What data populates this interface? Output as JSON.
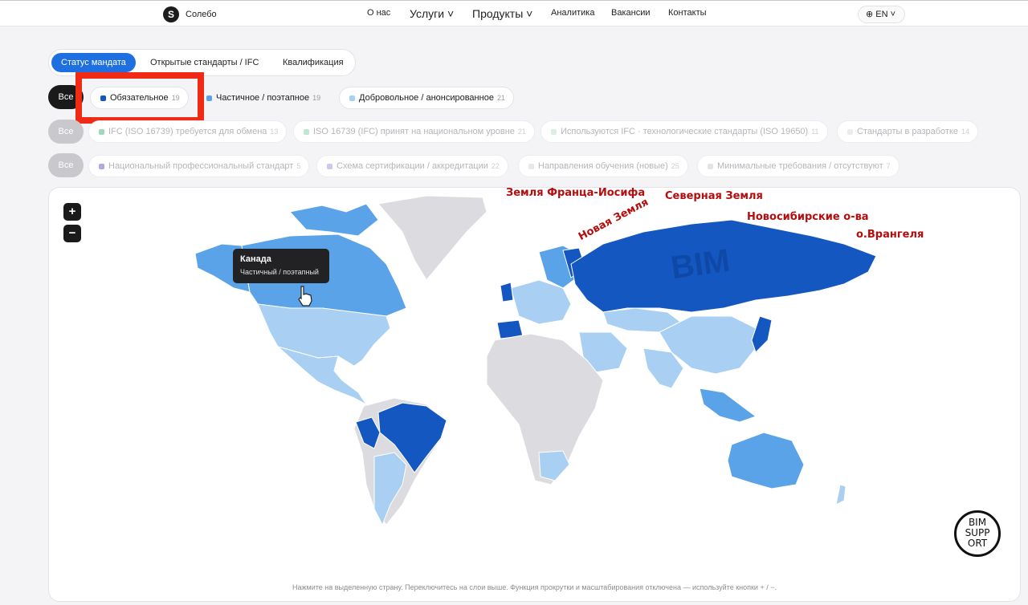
{
  "nav": {
    "brand_letter": "S",
    "brand": "Солебо",
    "items": [
      "О нас",
      "Услуги ˅",
      "Продукты ˅",
      "Аналитика",
      "Вакансии",
      "Контакты"
    ],
    "lang": "⊕ EN ˅"
  },
  "tabs": [
    "Статус мандата",
    "Открытые стандарты / IFC",
    "Квалификация"
  ],
  "rows": {
    "all_label": "Все",
    "mandate": [
      {
        "label": "Обязательное",
        "count": "19",
        "color": "#1557c0"
      },
      {
        "label": "Частичное / поэтапное",
        "count": "19",
        "color": "#5aa3e8"
      },
      {
        "label": "Добровольное / анонсированное",
        "count": "21",
        "color": "#a9d0f2"
      }
    ],
    "ifc": [
      {
        "label": "IFC (ISO 16739) требуется для обмена",
        "count": "13",
        "color": "#9fd9b9"
      },
      {
        "label": "ISO 16739 (IFC) принят на национальном уровне",
        "count": "21",
        "color": "#bfe6cf"
      },
      {
        "label": "Используются IFC · технологические стандарты (ISO 19650)",
        "count": "11",
        "color": "#d9efe2"
      },
      {
        "label": "Стандарты в разработке",
        "count": "14",
        "color": "#ececee"
      }
    ],
    "qual": [
      {
        "label": "Национальный профессиональный стандарт",
        "count": "5",
        "color": "#b8a6e0"
      },
      {
        "label": "Схема сертификации / аккредитации",
        "count": "22",
        "color": "#d2c5ee"
      },
      {
        "label": "Направления обучения (новые)",
        "count": "25",
        "color": "#e8e8eb"
      },
      {
        "label": "Минимальные требования / отсутствуют",
        "count": "7",
        "color": "#e4e4e7"
      }
    ]
  },
  "map": {
    "zoom_in": "+",
    "zoom_out": "−",
    "tooltip_title": "Канада",
    "tooltip_value": "Частичный / поэтапный",
    "footnote": "Нажмите на выделенную страну. Переключитесь на слои выше. Функция прокрутки и масштабирования отключена — используйте кнопки + / −.",
    "watermark": "BIM",
    "annotations": [
      "Земля Франца-Иосифа",
      "Новая Земля",
      "Северная Земля",
      "Новосибирские о-ва",
      "о.Врангеля"
    ],
    "legend_colors": {
      "mandatory": "#1557c0",
      "partial": "#5aa3e8",
      "voluntary": "#a9d0f2",
      "none": "#dcdbe0"
    }
  },
  "badge": {
    "line1": "BIM",
    "line2": "SUPP",
    "line3": "ORT"
  }
}
